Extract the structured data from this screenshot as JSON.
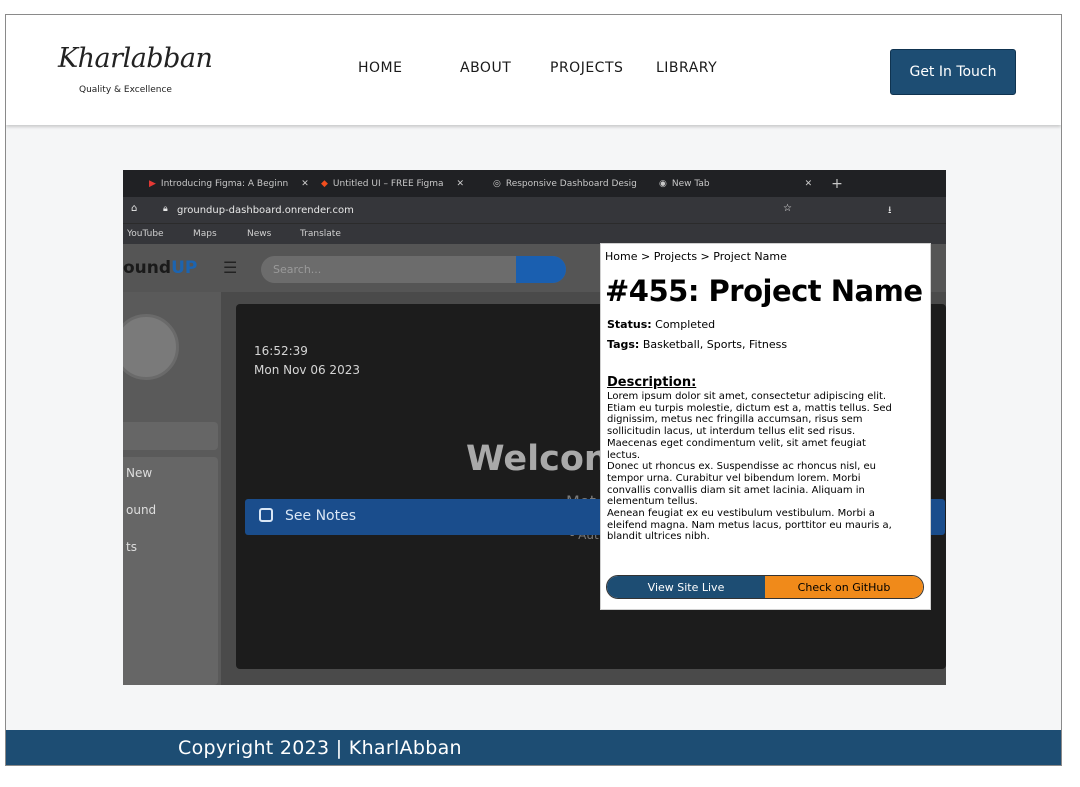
{
  "header": {
    "logo_text": "Kharlabban",
    "logo_tagline": "Quality & Excellence",
    "nav": [
      "HOME",
      "ABOUT",
      "PROJECTS",
      "LIBRARY"
    ],
    "cta_label": "Get In Touch"
  },
  "screenshot": {
    "tabs": [
      "Introducing Figma: A Beginn",
      "Untitled UI – FREE Figma",
      "Responsive Dashboard Desig",
      "New Tab"
    ],
    "url": "groundup-dashboard.onrender.com",
    "bookmarks": [
      "YouTube",
      "Maps",
      "News",
      "Translate"
    ],
    "brand_prefix": "ound",
    "brand_suffix": "UP",
    "search_placeholder": "Search...",
    "sidebar_items": [
      "New",
      "ound",
      "ts"
    ],
    "hero_time": "16:52:39",
    "hero_date": "Mon Nov 06 2023",
    "hero_welcome": "Welcon",
    "hero_sub": "Mot",
    "hero_author": "- Aut",
    "notes_label": "See Notes"
  },
  "project": {
    "breadcrumb": "Home > Projects > Project Name",
    "title": "#455: Project Name",
    "status_label": "Status:",
    "status_value": "Completed",
    "tags_label": "Tags:",
    "tags_value": "Basketball, Sports, Fitness",
    "description_heading": "Description:",
    "description": [
      "Lorem ipsum dolor sit amet, consectetur adipiscing elit. Etiam eu turpis molestie, dictum est a, mattis tellus. Sed dignissim, metus nec fringilla accumsan, risus sem sollicitudin lacus, ut interdum tellus elit sed risus. Maecenas eget condimentum velit, sit amet feugiat lectus.",
      "Donec ut rhoncus ex. Suspendisse ac rhoncus nisl, eu tempor urna. Curabitur vel bibendum lorem. Morbi convallis convallis diam sit amet lacinia. Aliquam in elementum tellus.",
      "Aenean feugiat ex eu vestibulum vestibulum. Morbi a eleifend magna. Nam metus lacus, porttitor eu mauris a, blandit ultrices nibh."
    ],
    "view_live_label": "View Site Live",
    "github_label": "Check on GitHub"
  },
  "footer": {
    "copyright": "Copyright 2023 | KharlAbban"
  },
  "colors": {
    "primary": "#1d4d73",
    "accent": "#f08a1a"
  }
}
